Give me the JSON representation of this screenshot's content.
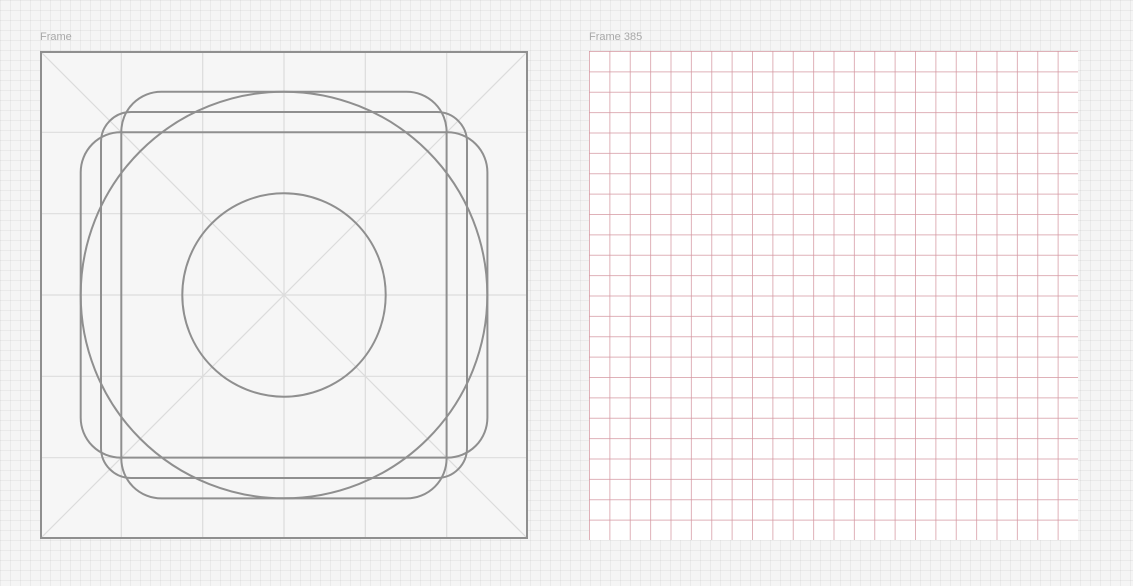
{
  "canvas": {
    "background_color": "#f5f5f5"
  },
  "frames": [
    {
      "label": "Frame",
      "content": "icon-keyline-template",
      "stroke_color": "#8f8f8f",
      "guide_color": "#dcdcdc"
    },
    {
      "label": "Frame 385",
      "content": "layout-grid",
      "grid_color": "#d496a0",
      "background_color": "#ffffff"
    }
  ]
}
